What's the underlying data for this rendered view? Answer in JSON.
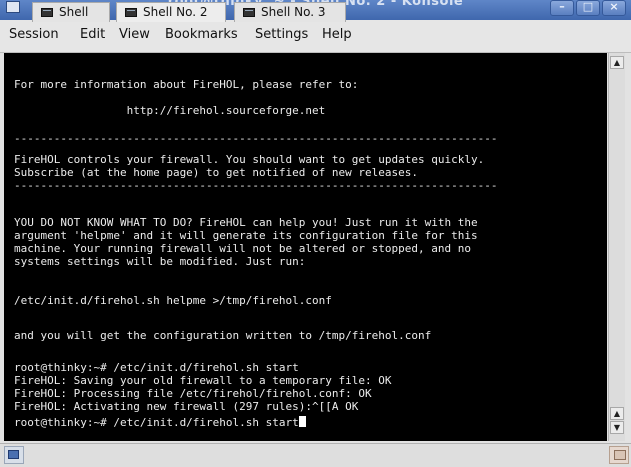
{
  "window": {
    "title": "root@thinky: ~ - Shell No. 2 - Konsole",
    "minimize_glyph": "–",
    "maximize_glyph": "□",
    "close_glyph": "×"
  },
  "menu": {
    "items": [
      "Session",
      "Edit",
      "View",
      "Bookmarks",
      "Settings",
      "Help"
    ]
  },
  "terminal": {
    "lines": [
      "For more information about FireHOL, please refer to:",
      "",
      "                 http://firehol.sourceforge.net",
      "",
      "-------------------------------------------------------------------------",
      "FireHOL controls your firewall. You should want to get updates quickly.",
      "Subscribe (at the home page) to get notified of new releases.",
      "-------------------------------------------------------------------------",
      "",
      "YOU DO NOT KNOW WHAT TO DO? FireHOL can help you! Just run it with the",
      "argument 'helpme' and it will generate its configuration file for this",
      "machine. Your running firewall will not be altered or stopped, and no",
      "systems settings will be modified. Just run:",
      "",
      "/etc/init.d/firehol.sh helpme >/tmp/firehol.conf",
      "",
      "and you will get the configuration written to /tmp/firehol.conf",
      "",
      "root@thinky:~# /etc/init.d/firehol.sh start",
      "FireHOL: Saving your old firewall to a temporary file: OK",
      "FireHOL: Processing file /etc/firehol/firehol.conf: OK",
      "FireHOL: Activating new firewall (297 rules):^[[A OK",
      "root@thinky:~# /etc/init.d/firehol.sh start"
    ]
  },
  "tabs": [
    {
      "label": "Shell",
      "active": false
    },
    {
      "label": "Shell No. 2",
      "active": true
    },
    {
      "label": "Shell No. 3",
      "active": false
    }
  ],
  "colors": {
    "titlebar": "#4f76bb",
    "terminal_bg": "#000000",
    "terminal_fg": "#ececec"
  },
  "icons": {
    "app": "konsole-icon",
    "new_tab": "new-session-icon",
    "close_tab": "close-session-icon",
    "tab": "terminal-icon"
  }
}
